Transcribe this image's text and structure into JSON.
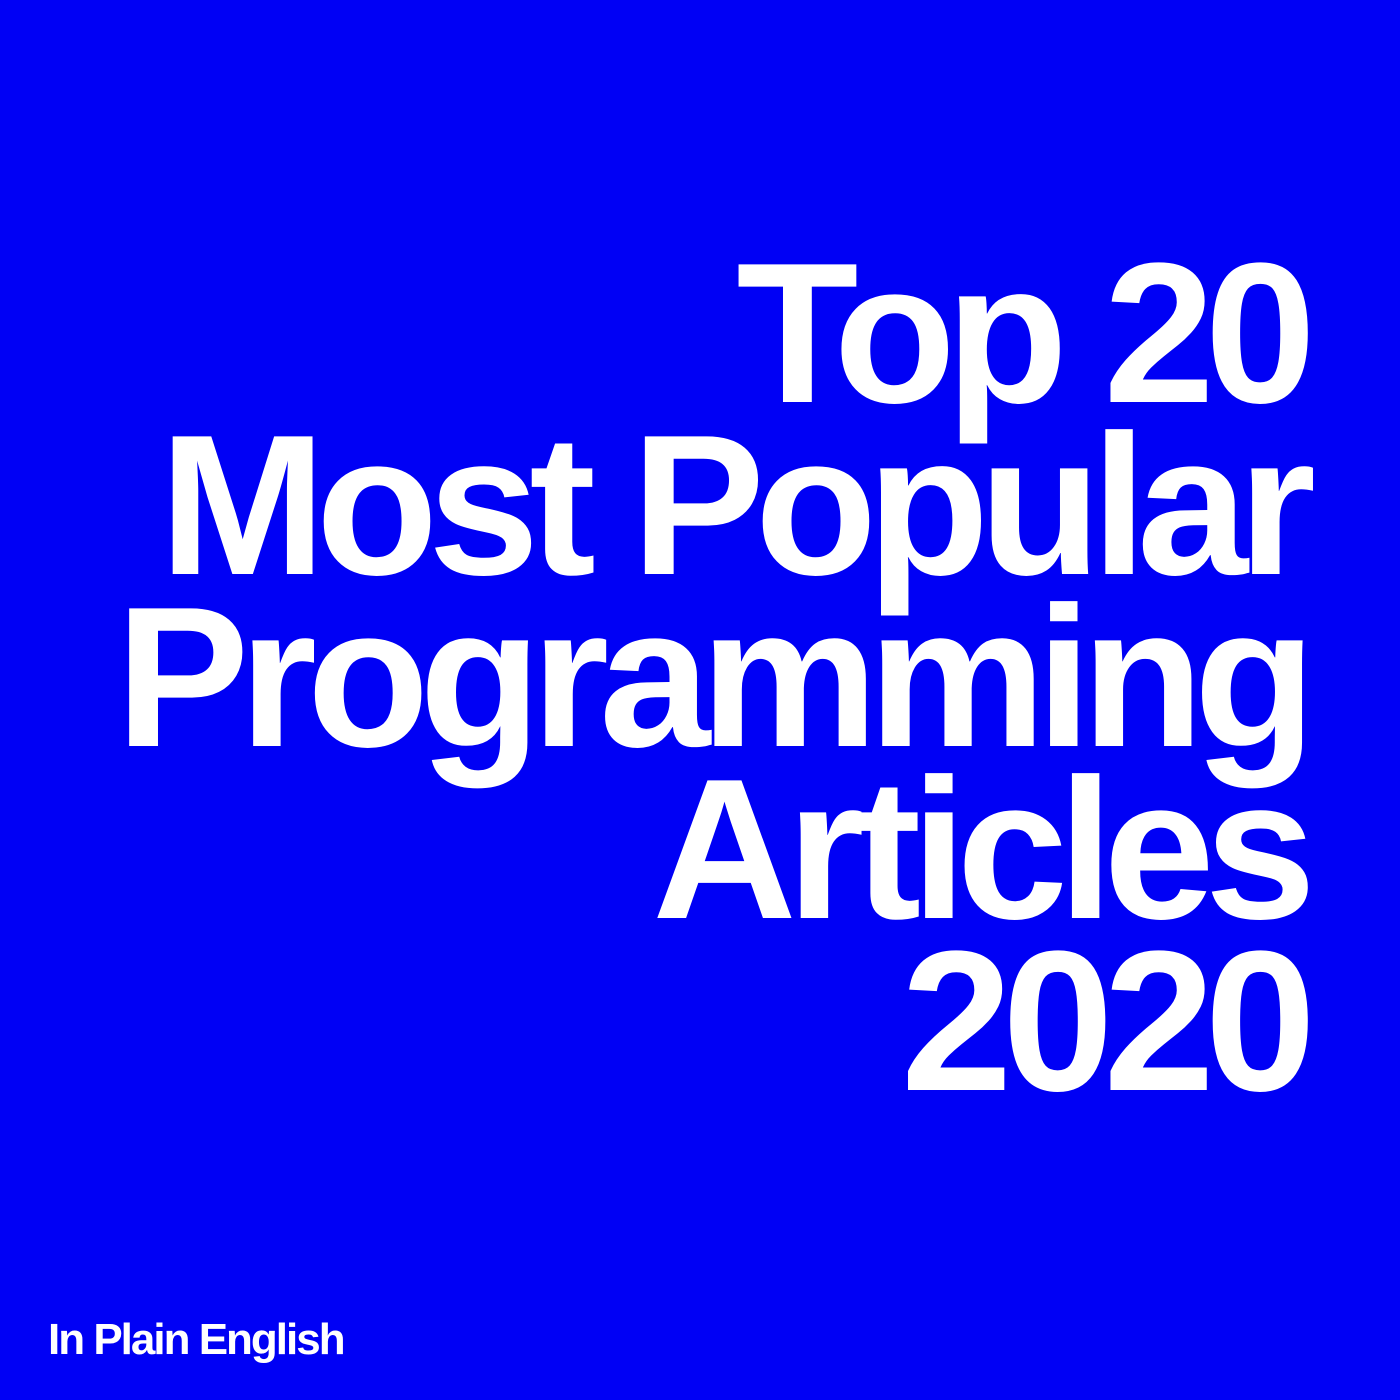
{
  "colors": {
    "background": "#0000f5",
    "text": "#ffffff"
  },
  "headline": {
    "lines": [
      "Top 20",
      "Most Popular",
      "Programming",
      "Articles",
      "2020"
    ]
  },
  "brand": {
    "name": "In Plain English"
  }
}
